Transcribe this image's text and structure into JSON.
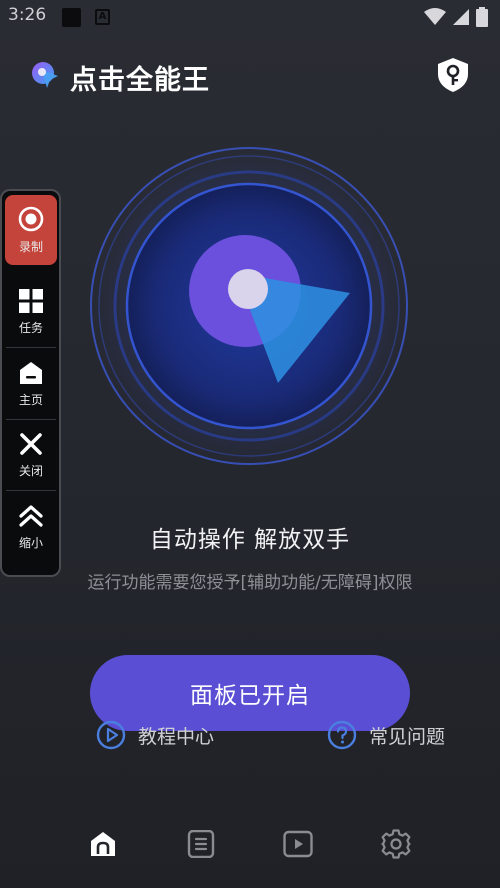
{
  "status_bar": {
    "time": "3:26",
    "badge_letter": "A"
  },
  "app": {
    "title": "点击全能王"
  },
  "side_panel": {
    "items": [
      {
        "label": "录制",
        "icon": "record-icon"
      },
      {
        "label": "任务",
        "icon": "grid-icon"
      },
      {
        "label": "主页",
        "icon": "home-icon"
      },
      {
        "label": "关闭",
        "icon": "close-icon"
      },
      {
        "label": "缩小",
        "icon": "double-chevron-up-icon"
      }
    ]
  },
  "hero": {
    "slogan": "自动操作 解放双手",
    "permission_text": "运行功能需要您授予[辅助功能/无障碍]权限"
  },
  "panel_button": {
    "label": "面板已开启"
  },
  "links": {
    "tutorial": "教程中心",
    "faq": "常见问题"
  },
  "bottom_nav": [
    {
      "icon": "home-icon",
      "active": true
    },
    {
      "icon": "list-icon",
      "active": false
    },
    {
      "icon": "play-icon",
      "active": false
    },
    {
      "icon": "settings-gear-icon",
      "active": false
    }
  ],
  "colors": {
    "accent": "#5a4fd4",
    "record_active": "#c4433a",
    "link_icon": "#4a7fe0",
    "background": "#26282f"
  }
}
